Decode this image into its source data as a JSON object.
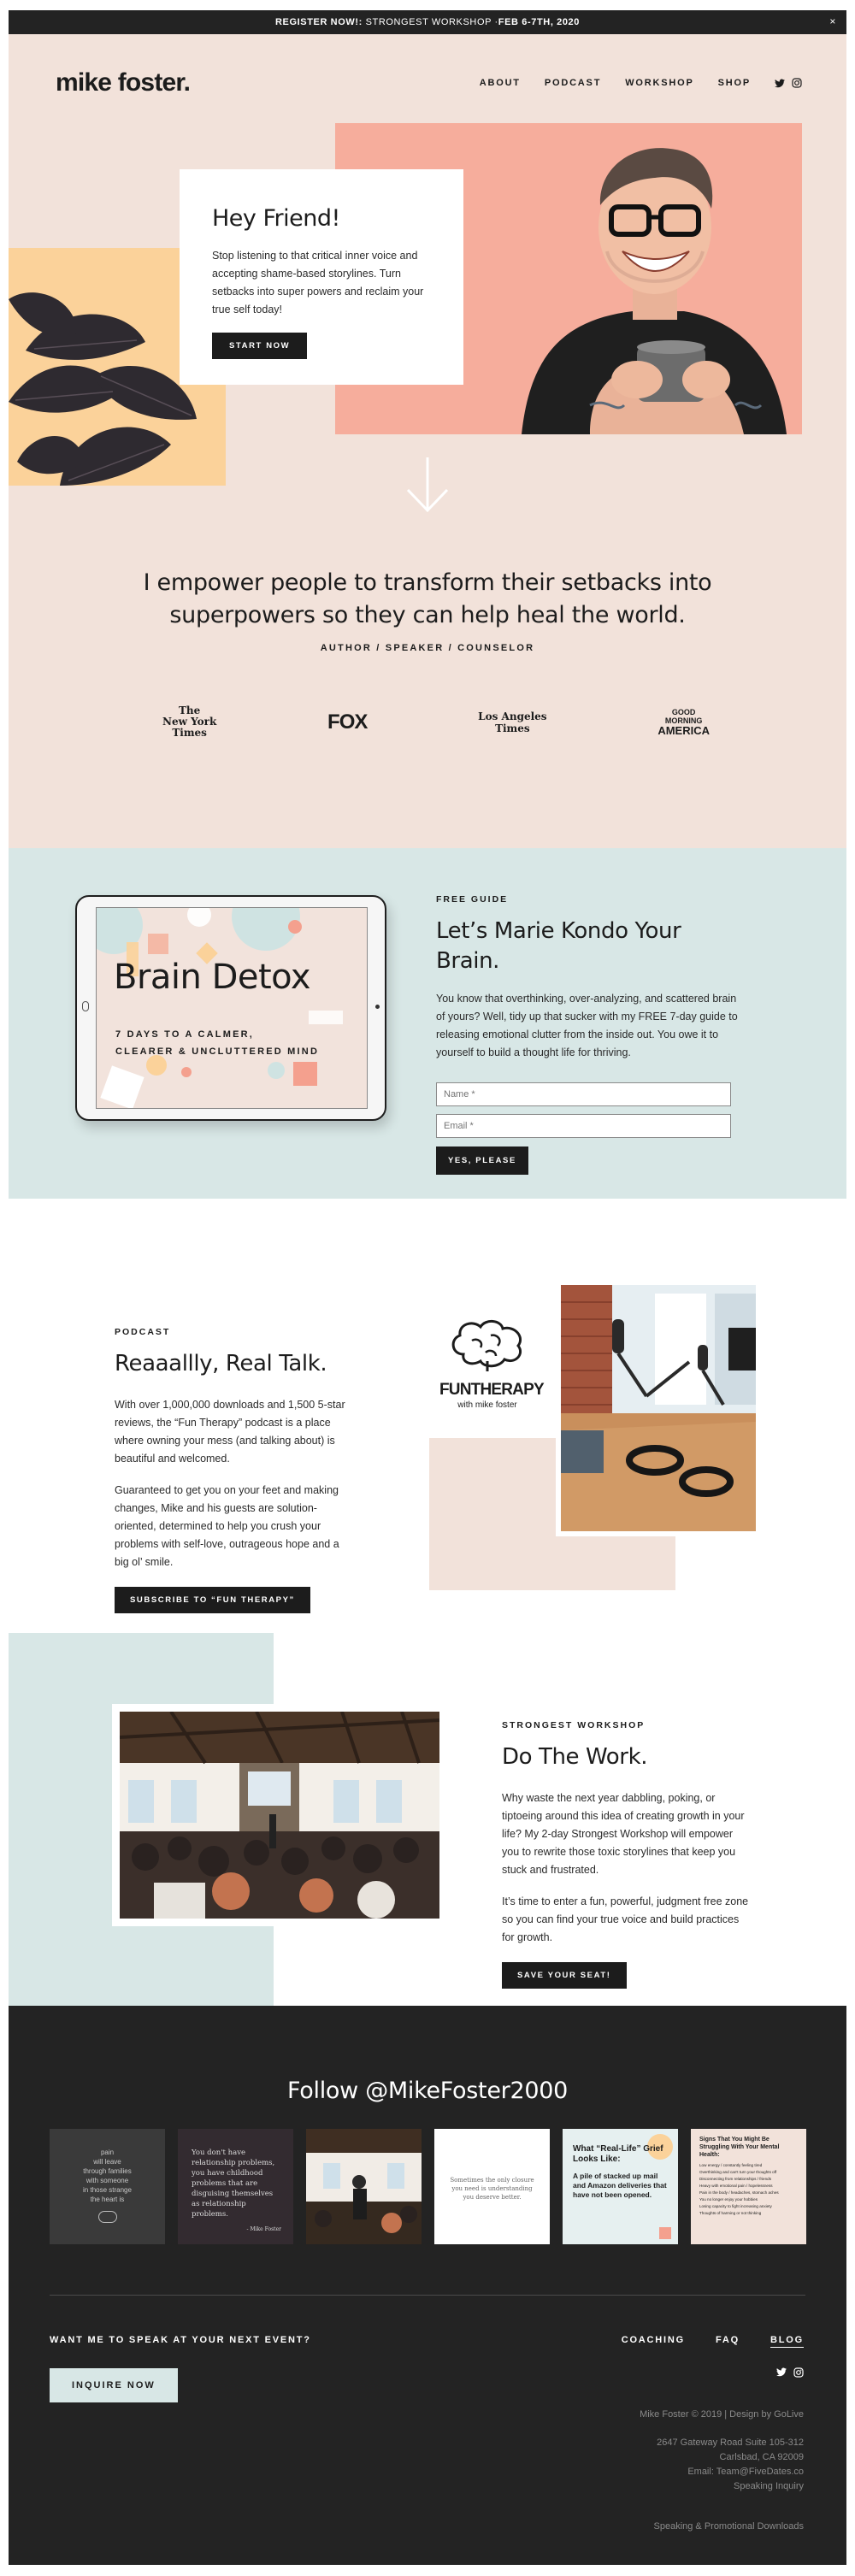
{
  "announcement": {
    "label": "REGISTER NOW!:",
    "text": "STRONGEST WORKSHOP · ",
    "date": "FEB 6-7TH, 2020",
    "close": "×"
  },
  "header": {
    "logo": "mike foster.",
    "nav": [
      "ABOUT",
      "PODCAST",
      "WORKSHOP",
      "SHOP"
    ]
  },
  "hero": {
    "title": "Hey Friend!",
    "body": "Stop listening to that critical inner voice and accepting shame-based storylines. Turn setbacks into super powers and reclaim your true self today!",
    "cta": "START NOW"
  },
  "mission": {
    "statement": "I empower people to transform their setbacks into superpowers so they can help heal the world.",
    "roles": "AUTHOR / SPEAKER / COUNSELOR"
  },
  "press": [
    {
      "line1": "The",
      "line2": "New York",
      "line3": "Times"
    },
    {
      "line1": "FOX"
    },
    {
      "line1": "Los Angeles",
      "line2": "Times"
    },
    {
      "line1": "GOOD",
      "line2": "MORNING",
      "line3": "AMERICA"
    }
  ],
  "detox": {
    "ipad_title": "Brain Detox",
    "ipad_sub1": "7 DAYS TO A CALMER,",
    "ipad_sub2": "CLEARER & UNCLUTTERED MIND",
    "kicker": "FREE GUIDE",
    "title": "Let’s Marie Kondo Your Brain.",
    "body": "You know that overthinking, over-analyzing, and scattered brain of yours? Well, tidy up that sucker with my FREE 7-day guide to releasing emotional clutter from the inside out. You owe it to yourself to build a thought life for thriving.",
    "name_placeholder": "Name *",
    "email_placeholder": "Email *",
    "submit": "YES, PLEASE"
  },
  "podcast": {
    "kicker": "PODCAST",
    "title": "Reaaallly, Real Talk.",
    "p1": "With over 1,000,000 downloads and 1,500 5-star reviews,  the “Fun Therapy” podcast is a place where owning your mess (and talking about) is beautiful and welcomed.",
    "p2": "Guaranteed to get you on your feet and making changes, Mike and his guests are solution-oriented, determined to help you crush your problems with self-love, outrageous hope and a big ol’ smile.",
    "cta": "SUBSCRIBE TO “FUN THERAPY”",
    "logo_title": "FUNTHERAPY",
    "logo_sub": "with mike foster"
  },
  "workshop": {
    "kicker": "STRONGEST WORKSHOP",
    "title": "Do The Work.",
    "p1": "Why waste the next year dabbling, poking, or tiptoeing around this idea of creating growth in your life? My 2-day Strongest Workshop will empower you to rewrite those toxic storylines that keep you stuck and frustrated.",
    "p2": "It’s time to enter a fun, powerful, judgment free zone so you can find your true voice and build practices for growth.",
    "cta": "SAVE YOUR SEAT!"
  },
  "footer": {
    "follow": "Follow @MikeFoster2000",
    "tiles": [
      {
        "kind": "quote-dark",
        "text": "pain\nwill leave\nthrough families\nwith someone\nin those strange\nthe heart is"
      },
      {
        "kind": "quote-dark2",
        "text": "You don't have relationship problems, you have childhood problems that are disguising themselves as relationship problems.",
        "sig": "- Mike Foster"
      },
      {
        "kind": "photo-stage"
      },
      {
        "kind": "quote-light",
        "text": "Sometimes the only closure you need is understanding you deserve better."
      },
      {
        "kind": "card-blue",
        "title": "What “Real-Life” Grief Looks Like:",
        "text": "A pile of stacked up mail and Amazon deliveries that have not been opened."
      },
      {
        "kind": "card-list",
        "title": "Signs That You Might Be Struggling With Your Mental Health:",
        "items": [
          "Low energy / constantly feeling tired",
          "Overthinking and can't turn your thoughts off",
          "Disconnecting from relationships / friends",
          "Heavy with emotional pain / hopelessness",
          "Pain in the body / headaches, stomach aches",
          "You no longer enjoy your hobbies",
          "Losing capacity to fight increasing anxiety",
          "Thoughts of harming or not thinking"
        ]
      }
    ],
    "speak_question": "WANT ME TO SPEAK AT YOUR NEXT EVENT?",
    "inquire": "INQUIRE NOW",
    "nav": [
      "COACHING",
      "FAQ",
      "BLOG"
    ],
    "copyright": "Mike Foster © 2019 | Design by GoLive",
    "address1": "2647 Gateway Road Suite 105-312",
    "address2": "Carlsbad, CA 92009",
    "email": "Email: Team@FiveDates.co",
    "speaking": "Speaking Inquiry",
    "downloads": "Speaking & Promotional Downloads"
  },
  "colors": {
    "peach_bg": "#f2e2da",
    "salmon": "#f6ad9c",
    "mint": "#d8e7e6",
    "yellow": "#fbd29a",
    "dark": "#232323"
  }
}
